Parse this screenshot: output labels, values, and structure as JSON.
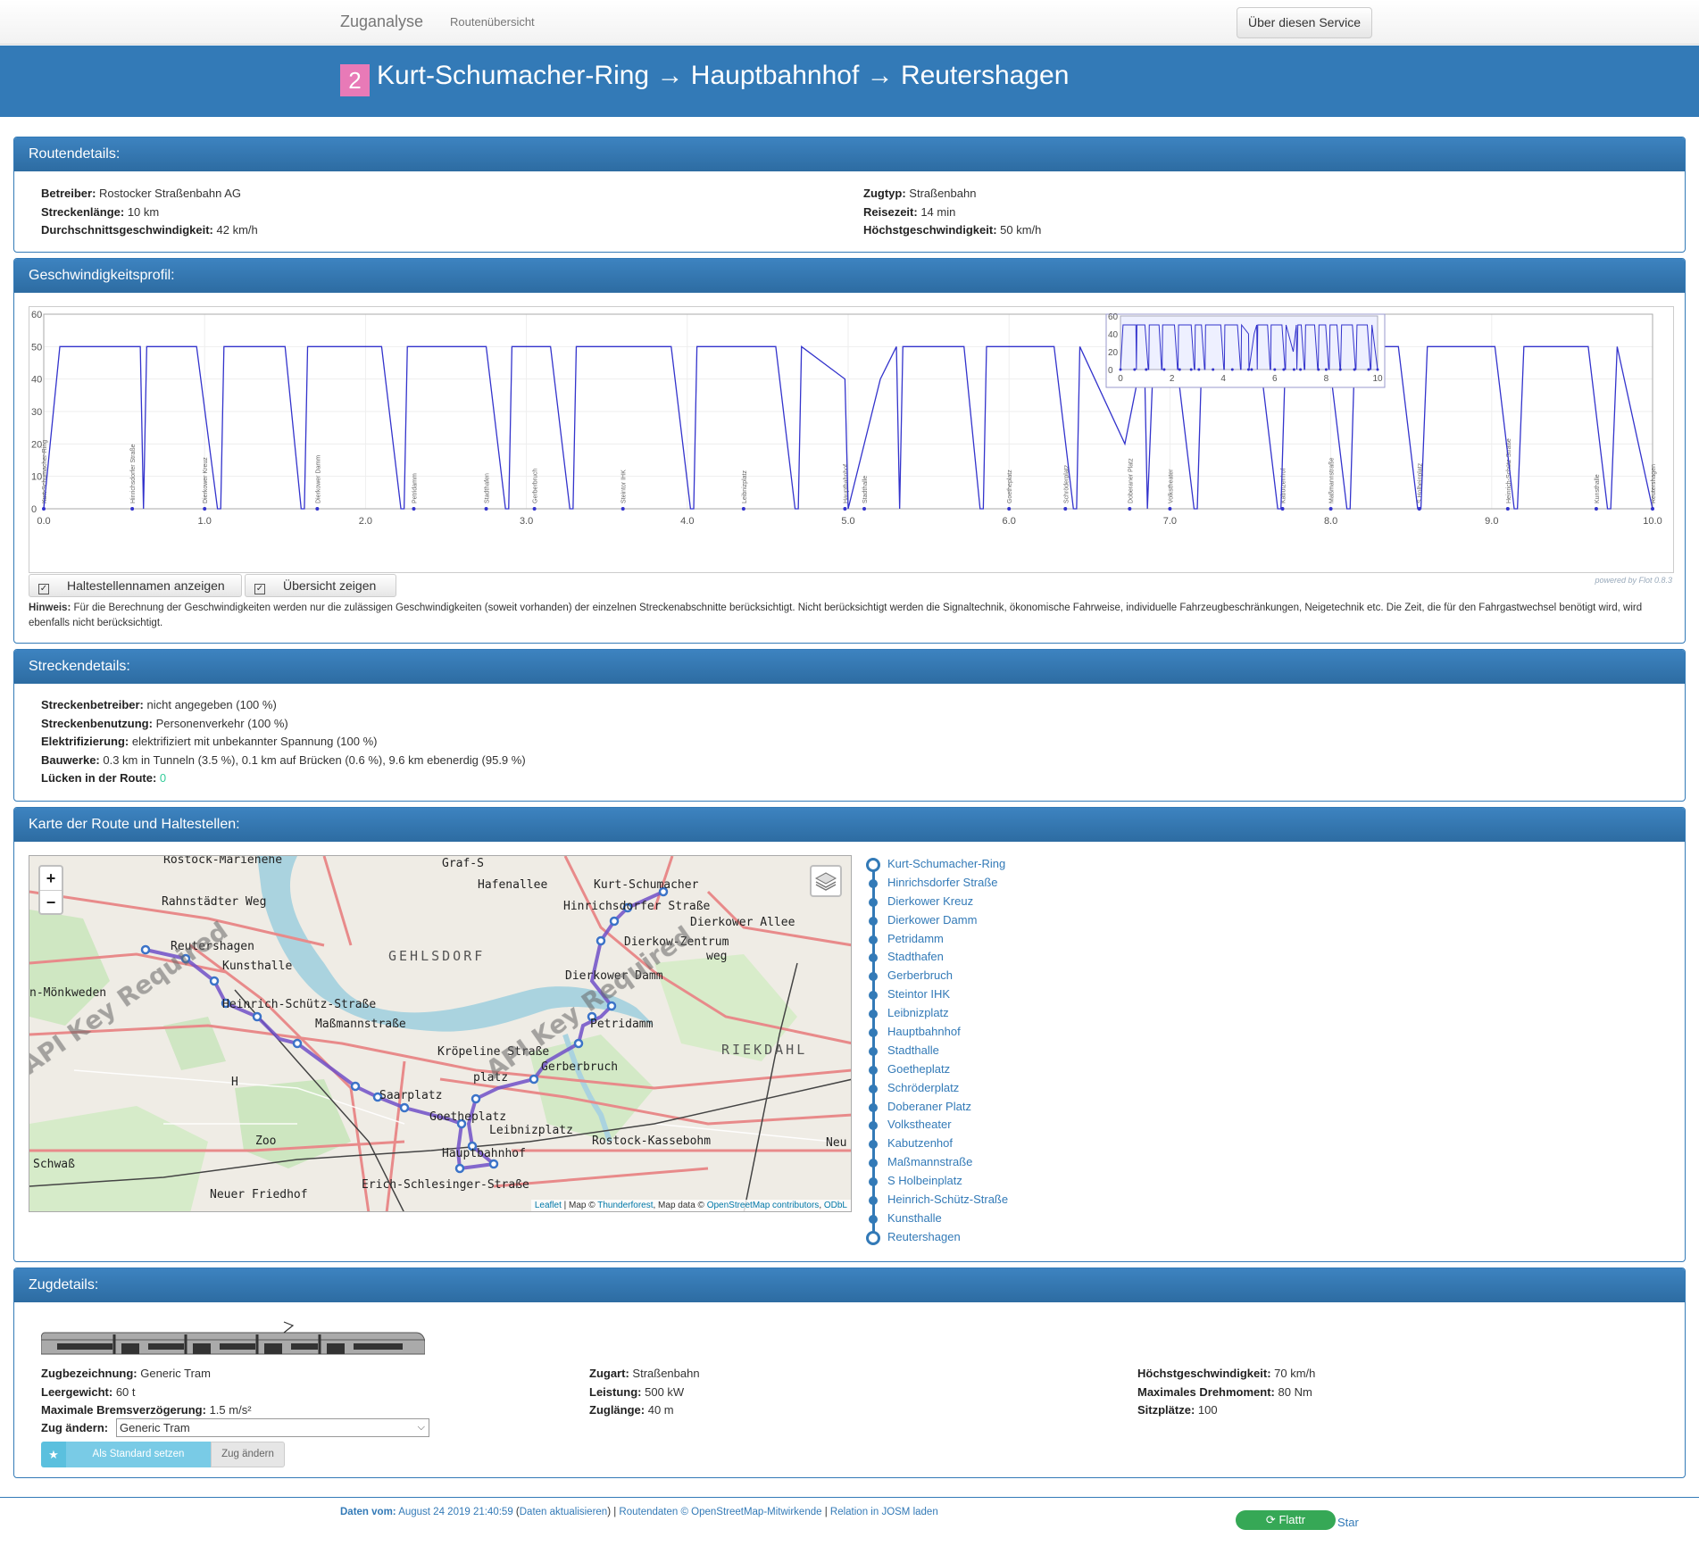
{
  "nav": {
    "brand": "Zuganalyse",
    "routes_link": "Routenübersicht",
    "about_button": "Über diesen Service"
  },
  "route": {
    "number": "2",
    "title": "Kurt-Schumacher-Ring → Hauptbahnhof → Reutershagen",
    "badge_color": "#e87ab7"
  },
  "route_details": {
    "heading": "Routendetails:",
    "left": [
      {
        "label": "Betreiber:",
        "value": "Rostocker Straßenbahn AG"
      },
      {
        "label": "Streckenlänge:",
        "value": "10 km"
      },
      {
        "label": "Durchschnittsgeschwindigkeit:",
        "value": "42 km/h"
      }
    ],
    "right": [
      {
        "label": "Zugtyp:",
        "value": "Straßenbahn"
      },
      {
        "label": "Reisezeit:",
        "value": "14 min"
      },
      {
        "label": "Höchstgeschwindigkeit:",
        "value": "50 km/h"
      }
    ]
  },
  "speed_profile": {
    "heading": "Geschwindigkeitsprofil:",
    "btn_names": "Haltestellennamen anzeigen",
    "btn_overview": "Übersicht zeigen",
    "note_label": "Hinweis:",
    "note_text": "Für die Berechnung der Geschwindigkeiten werden nur die zulässigen Geschwindigkeiten (soweit vorhanden) der einzelnen Streckenabschnitte berücksichtigt. Nicht berücksichtigt werden die Signaltechnik, ökonomische Fahrweise, individuelle Fahrzeugbeschränkungen, Neigetechnik etc. Die Zeit, die für den Fahrgastwechsel benötigt wird, wird ebenfalls nicht berücksichtigt.",
    "powered_by": "powered by Flot 0.8.3"
  },
  "chart_data": {
    "type": "line",
    "xlim": [
      0,
      10
    ],
    "ylim": [
      0,
      60
    ],
    "x_ticks": [
      "0.0",
      "1.0",
      "2.0",
      "3.0",
      "4.0",
      "5.0",
      "6.0",
      "7.0",
      "8.0",
      "9.0",
      "10.0"
    ],
    "y_ticks": [
      "0",
      "10",
      "20",
      "30",
      "40",
      "50",
      "60"
    ],
    "series": [
      {
        "x": [
          0,
          0.1,
          0.48,
          0.6,
          0.62,
          0.64,
          0.95,
          1.08,
          1.1,
          1.12,
          1.5,
          1.6,
          1.62,
          1.64,
          2.1,
          2.22,
          2.24,
          2.26,
          2.75,
          2.87,
          2.89,
          2.91,
          3.15,
          3.27,
          3.29,
          3.31,
          3.9,
          4.02,
          4.04,
          4.06,
          4.55,
          4.67,
          4.69,
          4.71,
          4.98,
          5.0,
          5.2,
          5.3,
          5.32,
          5.34,
          5.72,
          5.82,
          5.84,
          5.86,
          6.28,
          6.4,
          6.42,
          6.44,
          6.72,
          6.84,
          6.86,
          6.9,
          7.03,
          7.15,
          7.17,
          7.2,
          7.55,
          7.67,
          7.69,
          7.72,
          7.98,
          8.1,
          8.12,
          8.15,
          8.42,
          8.54,
          8.56,
          8.6,
          9.02,
          9.14,
          9.16,
          9.2,
          9.6,
          9.72,
          9.74,
          9.78,
          10.0
        ],
        "y": [
          0,
          50,
          50,
          50,
          0,
          50,
          50,
          0,
          0,
          50,
          50,
          0,
          0,
          50,
          50,
          0,
          0,
          50,
          50,
          0,
          0,
          50,
          50,
          0,
          0,
          50,
          50,
          0,
          0,
          50,
          50,
          0,
          0,
          50,
          40,
          0,
          40,
          50,
          0,
          50,
          50,
          0,
          0,
          50,
          50,
          0,
          0,
          50,
          20,
          50,
          0,
          50,
          50,
          0,
          0,
          50,
          50,
          0,
          0,
          50,
          50,
          0,
          0,
          50,
          50,
          0,
          0,
          50,
          50,
          0,
          0,
          50,
          50,
          0,
          0,
          50,
          0
        ]
      }
    ],
    "stop_labels": [
      "Kurt-Schumacher-Ring",
      "Hinrichsdorfer Straße",
      "Dierkower Kreuz",
      "Dierkower Damm",
      "Petridamm",
      "Stadthafen",
      "Gerberbruch",
      "Steintor IHK",
      "Leibnizplatz",
      "Hauptbahnhof",
      "Stadthalle",
      "Goetheplatz",
      "Schröderplatz",
      "Doberaner Platz",
      "Volkstheater",
      "Kabutzenhof",
      "Maßmannstraße",
      "S Holbeinplatz",
      "Heinrich-Schütz-Straße",
      "Kunsthalle",
      "Reutershagen"
    ],
    "stop_km": [
      0.0,
      0.55,
      1.0,
      1.7,
      2.3,
      2.75,
      3.05,
      3.6,
      4.35,
      4.98,
      5.1,
      6.0,
      6.35,
      6.75,
      7.0,
      7.7,
      8.0,
      8.55,
      9.1,
      9.65,
      10.0
    ],
    "line_color": "#3333cc",
    "overview_x_ticks": [
      "0",
      "2",
      "4",
      "6",
      "8",
      "10"
    ],
    "overview_y_ticks": [
      "0",
      "20",
      "40",
      "60"
    ]
  },
  "track_details": {
    "heading": "Streckendetails:",
    "items": [
      {
        "label": "Streckenbetreiber:",
        "value": "nicht angegeben (100 %)"
      },
      {
        "label": "Streckenbenutzung:",
        "value": "Personenverkehr (100 %)"
      },
      {
        "label": "Elektrifizierung:",
        "value": "elektrifiziert mit unbekannter Spannung (100 %)"
      },
      {
        "label": "Bauwerke:",
        "value": "0.3 km in Tunneln (3.5 %), 0.1 km auf Brücken (0.6 %), 9.6 km ebenerdig (95.9 %)"
      },
      {
        "label": "Lücken in der Route:",
        "value": "0"
      }
    ]
  },
  "map_section": {
    "heading": "Karte der Route und Haltestellen:",
    "zoom_in": "+",
    "zoom_out": "−",
    "attribution_leaflet": "Leaflet",
    "attribution_map": " | Map © ",
    "attribution_tf": "Thunderforest",
    "attribution_data": ", Map data © ",
    "attribution_osm": "OpenStreetMap contributors",
    "attribution_odbl": "ODbL",
    "watermark": "API Key Required",
    "place_labels": [
      "Rostock-Marienehe",
      "Graf-S",
      "Hafenallee",
      "Kurt-Schumacher",
      "Rahnstädter Weg",
      "Hinrichsdorfer Straße",
      "Dierkower Allee",
      "Reutershagen",
      "Dierkow-Zentrum",
      "weg",
      "Kunsthalle",
      "GEHLSDORF",
      "Dierkower Damm",
      "n-Mönkweden",
      "Heinrich-Schütz-Straße",
      "Petridamm",
      "Maßmannstraße",
      "RIEKDAHL",
      "Kröpeline Straße",
      "Gerberbruch",
      "H",
      "platz",
      "Saarplatz",
      "Goetheplatz",
      "Leibnizplatz",
      "Zoo",
      "Rostock-Kassebohm",
      "Neu",
      "Hauptbahnhof",
      "Schwaß",
      "Neuer Friedhof",
      "Erich-Schlesinger-Straße"
    ],
    "stops": [
      "Kurt-Schumacher-Ring",
      "Hinrichsdorfer Straße",
      "Dierkower Kreuz",
      "Dierkower Damm",
      "Petridamm",
      "Stadthafen",
      "Gerberbruch",
      "Steintor IHK",
      "Leibnizplatz",
      "Hauptbahnhof",
      "Stadthalle",
      "Goetheplatz",
      "Schröderplatz",
      "Doberaner Platz",
      "Volkstheater",
      "Kabutzenhof",
      "Maßmannstraße",
      "S Holbeinplatz",
      "Heinrich-Schütz-Straße",
      "Kunsthalle",
      "Reutershagen"
    ]
  },
  "train_details": {
    "heading": "Zugdetails:",
    "col1": [
      {
        "label": "Zugbezeichnung:",
        "value": "Generic Tram"
      },
      {
        "label": "Leergewicht:",
        "value": "60 t"
      },
      {
        "label": "Maximale Bremsverzögerung:",
        "value": "1.5 m/s²"
      }
    ],
    "col2": [
      {
        "label": "Zugart:",
        "value": "Straßenbahn"
      },
      {
        "label": "Leistung:",
        "value": "500 kW"
      },
      {
        "label": "Zuglänge:",
        "value": "40 m"
      }
    ],
    "col3": [
      {
        "label": "Höchstgeschwindigkeit:",
        "value": "70 km/h"
      },
      {
        "label": "Maximales Drehmoment:",
        "value": "80 Nm"
      },
      {
        "label": "Sitzplätze:",
        "value": "100"
      }
    ],
    "change_label": "Zug ändern:",
    "select_value": "Generic Tram",
    "btn_star": "★",
    "btn_default": "Als Standard setzen",
    "btn_change": "Zug ändern"
  },
  "footer": {
    "data_label": "Daten vom:",
    "date": "August 24 2019 21:40:59",
    "refresh_open": " (",
    "refresh": "Daten aktualisieren",
    "refresh_close": ") | ",
    "routedata": "Routendaten © OpenStreetMap-Mitwirkende",
    "sep": " | ",
    "josm": "Relation in JOSM laden",
    "flattr": "Flattr",
    "star": "Star"
  }
}
